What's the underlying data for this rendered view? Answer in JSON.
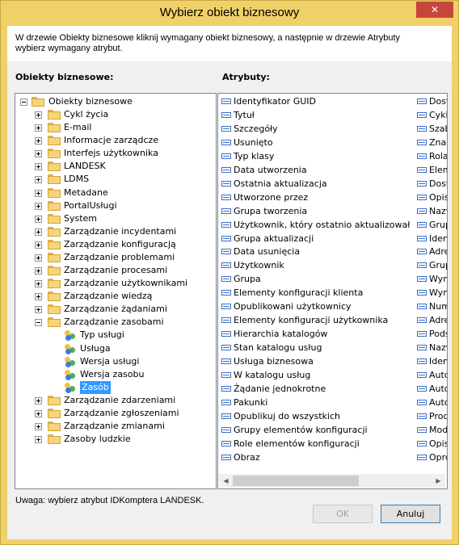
{
  "window": {
    "title": "Wybierz obiekt biznesowy",
    "close_glyph": "✕"
  },
  "header": {
    "instruction": "W drzewie Obiekty biznesowe kliknij wymagany obiekt biznesowy, a następnie w drzewie Atrybuty wybierz wymagany atrybut."
  },
  "left_panel": {
    "label": "Obiekty biznesowe:",
    "root": "Obiekty biznesowe",
    "items": [
      "Cykl życia",
      "E-mail",
      "Informacje zarządcze",
      "Interfejs użytkownika",
      "LANDESK",
      "LDMS",
      "Metadane",
      "PortalUsługi",
      "System",
      "Zarządzanie incydentami",
      "Zarządzanie konfiguracją",
      "Zarządzanie problemami",
      "Zarządzanie procesami",
      "Zarządzanie użytkownikami",
      "Zarządzanie wiedzą",
      "Zarządzanie żądaniami",
      "Zarządzanie zasobami",
      "Typ usługi",
      "Usługa",
      "Wersja usługi",
      "Wersja zasobu",
      "Zasób",
      "Zarządzanie zdarzeniami",
      "Zarządzanie zgłoszeniami",
      "Zarządzanie zmianami",
      "Zasoby ludzkie"
    ],
    "selected": "Zasób"
  },
  "right_panel": {
    "label": "Atrybuty:",
    "col1": [
      "Identyfikator GUID",
      "Tytuł",
      "Szczegóły",
      "Usunięto",
      "Typ klasy",
      "Data utworzenia",
      "Ostatnia aktualizacja",
      "Utworzone przez",
      "Grupa tworzenia",
      "Użytkownik, który ostatnio aktualizował",
      "Grupa aktualizacji",
      "Data usunięcia",
      "Użytkownik",
      "Grupa",
      "Elementy konfiguracji klienta",
      "Opublikowani użytkownicy",
      "Elementy konfiguracji użytkownika",
      "Hierarchia katalogów",
      "Stan katalogu usług",
      "Usługa biznesowa",
      "W katalogu usług",
      "Żądanie jednokrotne",
      "Pakunki",
      "Opublikuj do wszystkich",
      "Grupy elementów konfiguracji",
      "Role elementów konfiguracji",
      "Obraz"
    ],
    "col2": [
      "Dost",
      "Cykl",
      "Szab",
      "Znac",
      "Rolal",
      "Elem",
      "Dost",
      "Opis",
      "Nazw",
      "Grup",
      "Iden",
      "Adre",
      "Grup",
      "Wym",
      "Wym",
      "Num",
      "Adre",
      "Pods",
      "Nazw",
      "Iden",
      "Auto",
      "Auto",
      "Auto",
      "Prod",
      "Mode",
      "Opis",
      "Oprc"
    ],
    "scroll_left": "◀",
    "scroll_right": "▶"
  },
  "footer": {
    "note": "Uwaga: wybierz atrybut IDKomptera LANDESK.",
    "ok_label": "OK",
    "cancel_label": "Anuluj"
  }
}
